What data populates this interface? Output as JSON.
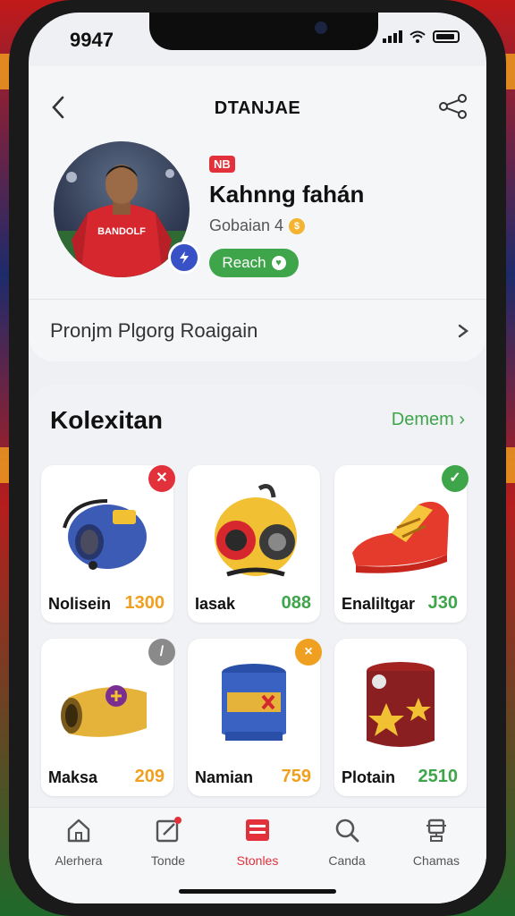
{
  "status": {
    "time": "9947"
  },
  "header": {
    "title": "DTANJAE"
  },
  "profile": {
    "tag": "NB",
    "name": "Kahnng fahán",
    "subtitle": "Gobaian 4",
    "action_label": "Reach",
    "jersey_text": "BANDOLF"
  },
  "program_row": {
    "label": "Pronjm Plgorg Roaigain"
  },
  "collection": {
    "title": "Kolexitan",
    "more_label": "Demem",
    "items": [
      {
        "name": "Nolisein",
        "value": "1300",
        "value_color": "#f0a020",
        "status": "x",
        "status_color": "#e2313a",
        "art": "blue-armband"
      },
      {
        "name": "Iasak",
        "value": "088",
        "value_color": "#3ea54a",
        "status": "",
        "status_color": "",
        "art": "yellow-helmet"
      },
      {
        "name": "Enaliltgar",
        "value": "J30",
        "value_color": "#3ea54a",
        "status": "✓",
        "status_color": "#3ea54a",
        "art": "red-boot"
      },
      {
        "name": "Maksa",
        "value": "209",
        "value_color": "#f0a020",
        "status": "/",
        "status_color": "#8a8a8a",
        "art": "yellow-band"
      },
      {
        "name": "Namian",
        "value": "759",
        "value_color": "#f0a020",
        "status": "×",
        "status_color": "#f0a020",
        "art": "blue-vest"
      },
      {
        "name": "Plotain",
        "value": "2510",
        "value_color": "#3ea54a",
        "status": "",
        "status_color": "",
        "art": "star-box"
      }
    ]
  },
  "tabs": [
    {
      "label": "Alerhera",
      "icon": "home-icon"
    },
    {
      "label": "Tonde",
      "icon": "edit-icon"
    },
    {
      "label": "Stonles",
      "icon": "cards-icon",
      "active": true
    },
    {
      "label": "Canda",
      "icon": "search-icon"
    },
    {
      "label": "Chamas",
      "icon": "trophy-icon"
    }
  ],
  "colors": {
    "accent_green": "#3ea54a",
    "accent_red": "#e2313a",
    "brand_blue": "#3851c7"
  }
}
